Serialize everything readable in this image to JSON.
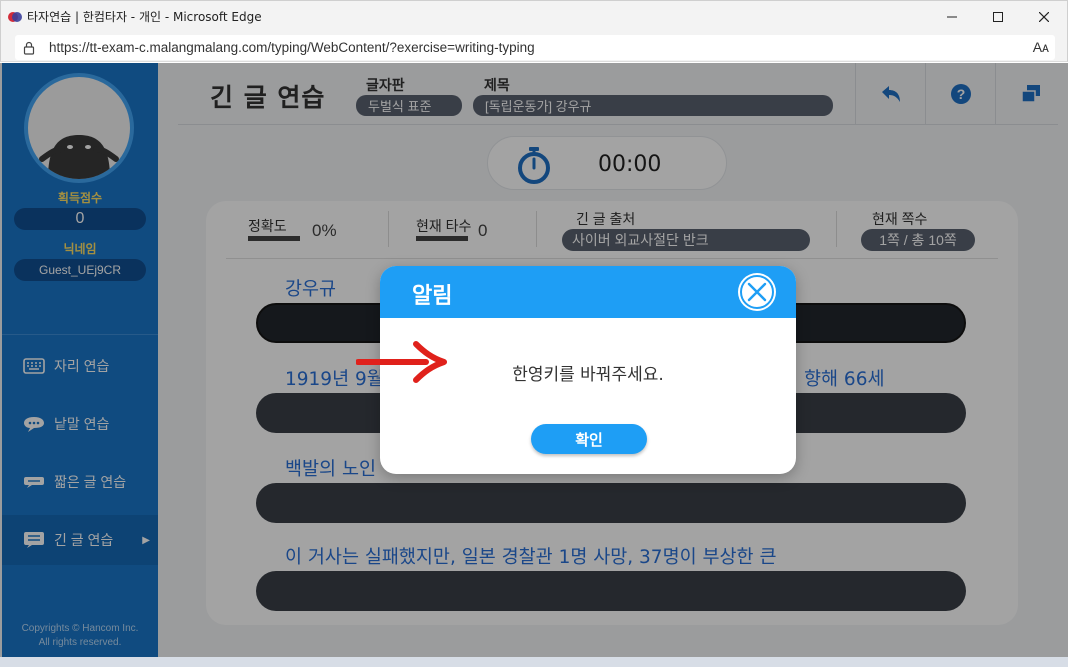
{
  "browser": {
    "window_title": "타자연습 | 한컴타자 - 개인 - Microsoft Edge",
    "url": "https://tt-exam-c.malangmalang.com/typing/WebContent/?exercise=writing-typing",
    "reader_mode_glyph": "Aᴀ"
  },
  "sidebar": {
    "score_label": "획득점수",
    "score_value": "0",
    "nickname_label": "닉네임",
    "nickname_value": "Guest_UEj9CR",
    "menu": [
      {
        "label": "자리 연습",
        "icon": "keyboard-icon"
      },
      {
        "label": "낱말 연습",
        "icon": "speech-bubble-icon"
      },
      {
        "label": "짧은 글 연습",
        "icon": "short-text-icon"
      },
      {
        "label": "긴 글 연습",
        "icon": "long-text-icon"
      }
    ],
    "copyright": [
      "Copyrights © Hancom Inc.",
      "All rights reserved."
    ]
  },
  "header": {
    "title": "긴 글 연습",
    "keyboard_label": "글자판",
    "keyboard_value": "두벌식 표준",
    "subject_label": "제목",
    "subject_value": "[독립운동가] 강우규"
  },
  "timer": {
    "value": "00:00"
  },
  "stats": {
    "accuracy_label": "정확도",
    "accuracy_value": "0%",
    "speed_label": "현재 타수",
    "speed_value": "0",
    "source_label": "긴 글 출처",
    "source_value": "사이버 외교사절단 반크",
    "page_label": "현재 쪽수",
    "page_value": "1쪽 / 총 10쪽"
  },
  "lines": [
    {
      "text": "강우규"
    },
    {
      "text": "1919년 9월",
      "tail": "향해 66세"
    },
    {
      "text": "백발의 노인"
    },
    {
      "text": "이 거사는 실패했지만, 일본 경찰관 1명 사망, 37명이 부상한 큰"
    }
  ],
  "modal": {
    "title": "알림",
    "message": "한영키를 바꿔주세요.",
    "ok_label": "확인"
  },
  "colors": {
    "sidebar": "#1a76c8",
    "modal_header": "#1e9ef5",
    "annotation_arrow": "#e0211b"
  }
}
